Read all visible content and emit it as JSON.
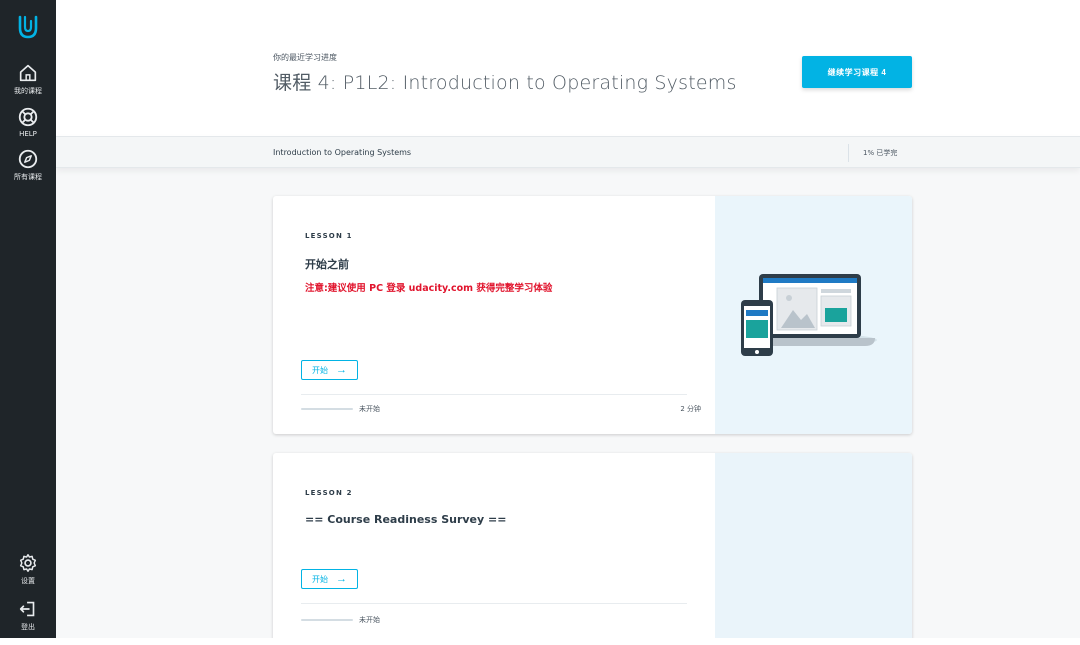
{
  "sidebar": {
    "logo": "udacity-logo-icon",
    "items": [
      {
        "label": "我的课程",
        "icon": "home-icon"
      },
      {
        "label": "HELP",
        "icon": "lifebuoy-icon"
      },
      {
        "label": "所有课程",
        "icon": "compass-icon"
      }
    ],
    "bottom_items": [
      {
        "label": "设置",
        "icon": "gear-icon"
      },
      {
        "label": "登出",
        "icon": "logout-icon"
      }
    ]
  },
  "header": {
    "eyebrow": "你的最近学习进度",
    "title": "课程 4:  P1L2: Introduction to Operating Systems",
    "continue_button": "继续学习课程 4"
  },
  "subbar": {
    "course_title": "Introduction to Operating Systems",
    "progress": "1% 已学完"
  },
  "lessons": [
    {
      "number": "LESSON 1",
      "title": "开始之前",
      "note": "注意:建议使用 PC 登录 udacity.com 获得完整学习体验",
      "button": "开始",
      "status": "未开始",
      "duration": "2 分钟"
    },
    {
      "number": "LESSON 2",
      "title": "== Course Readiness Survey ==",
      "button": "开始",
      "status": "未开始"
    }
  ],
  "colors": {
    "sidebar": "#1f2529",
    "accent": "#02b3e4",
    "note": "#e1142d",
    "art_bg": "#eaf5fb"
  }
}
